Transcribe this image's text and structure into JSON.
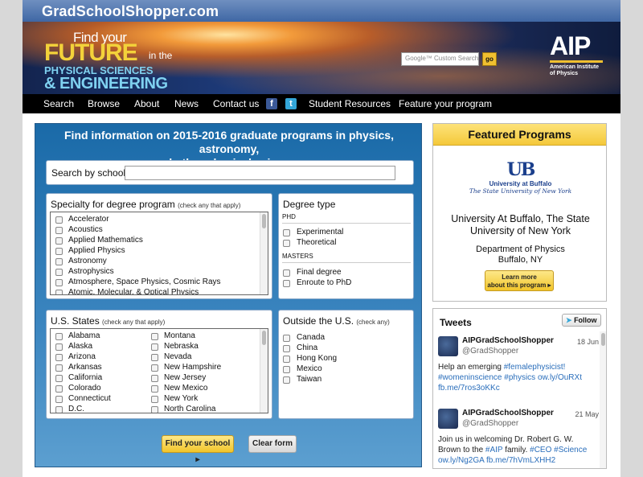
{
  "site": {
    "name": "GradSchoolShopper.com"
  },
  "banner": {
    "line1": "Find your",
    "line2": "FUTURE",
    "line2b": "in the",
    "line3": "PHYSICAL SCIENCES",
    "line4": "& ENGINEERING",
    "search_placeholder": "Google™ Custom Search",
    "go_label": "go",
    "aip_logo": "AIP",
    "aip_name_1": "American Institute",
    "aip_name_2": "of Physics"
  },
  "nav": {
    "items": [
      "Search",
      "Browse",
      "About",
      "News",
      "Contact us",
      "Student Resources",
      "Feature your program"
    ],
    "facebook_icon": "f",
    "twitter_icon": "t"
  },
  "search": {
    "title_1": "Find information on 2015-2016 graduate programs in physics, astronomy,",
    "title_2": "and other physical sciences:",
    "by_school_label": "Search by school",
    "specialty": {
      "heading": "Specialty for degree program",
      "hint": "(check any that apply)",
      "items": [
        "Accelerator",
        "Acoustics",
        "Applied Mathematics",
        "Applied Physics",
        "Astronomy",
        "Astrophysics",
        "Atmosphere, Space Physics, Cosmic Rays",
        "Atomic, Molecular, & Optical Physics"
      ]
    },
    "degree": {
      "heading": "Degree type",
      "phd_label": "PHD",
      "phd_items": [
        "Experimental",
        "Theoretical"
      ],
      "masters_label": "MASTERS",
      "masters_items": [
        "Final degree",
        "Enroute to PhD"
      ]
    },
    "states": {
      "heading": "U.S. States",
      "hint": "(check any that apply)",
      "col1": [
        "Alabama",
        "Alaska",
        "Arizona",
        "Arkansas",
        "California",
        "Colorado",
        "Connecticut",
        "D.C."
      ],
      "col2": [
        "Montana",
        "Nebraska",
        "Nevada",
        "New Hampshire",
        "New Jersey",
        "New Mexico",
        "New York",
        "North Carolina"
      ]
    },
    "outside": {
      "heading": "Outside the U.S.",
      "hint": "(check any)",
      "items": [
        "Canada",
        "China",
        "Hong Kong",
        "Mexico",
        "Taiwan"
      ]
    },
    "find_button": "Find your school ▸",
    "clear_button": "Clear form"
  },
  "featured": {
    "heading": "Featured Programs",
    "logo_mark": "UB",
    "logo_line1": "University at Buffalo",
    "logo_line2": "The State University of New York",
    "school_1": "University At Buffalo, The State",
    "school_2": "University of New York",
    "dept": "Department of Physics",
    "location": "Buffalo, NY",
    "learn_1": "Learn more",
    "learn_2": "about this program ▸"
  },
  "tweets": {
    "heading": "Tweets",
    "follow": "Follow",
    "items": [
      {
        "name": "AIPGradSchoolShopper",
        "handle": "@GradShopper",
        "date": "18 Jun",
        "text_1": "Help an emerging ",
        "link_1": "#femalephysicist!",
        "text_2": "#womeninscience #physics  ow.ly/OuRXt",
        "text_3": "fb.me/7ros3oKKc"
      },
      {
        "name": "AIPGradSchoolShopper",
        "handle": "@GradShopper",
        "date": "21 May",
        "text_1": "Join us in welcoming Dr. Robert G. W.",
        "text_2": "Brown to the ",
        "link_2": "#AIP",
        "text_2b": " family. ",
        "link_3": "#CEO #Science",
        "text_3": "ow.ly/Ng2GA fb.me/7hVmLXHH2"
      }
    ]
  },
  "colors": {
    "panel_blue": "#1a6aa8",
    "accent_yellow": "#f4c83a",
    "link": "#2a6ebb"
  }
}
